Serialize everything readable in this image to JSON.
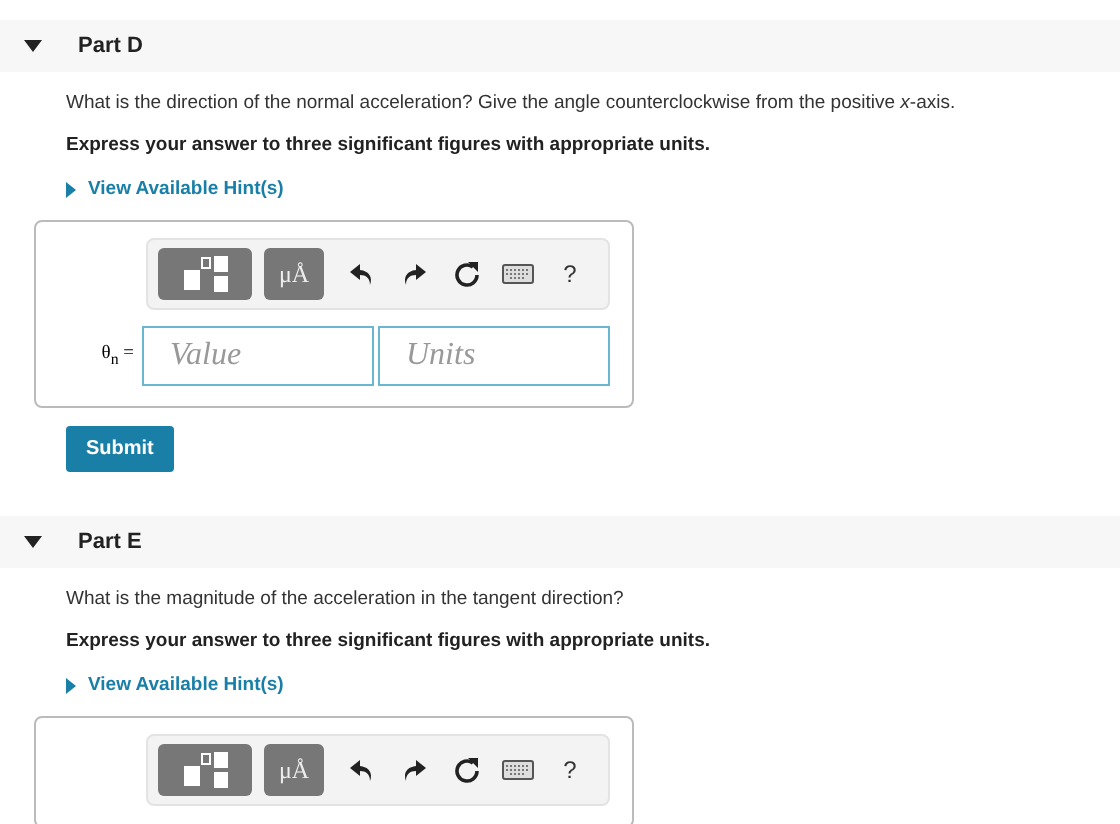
{
  "parts": [
    {
      "title": "Part D",
      "expanded": true,
      "question": "What is the direction of the normal acceleration? Give the angle counterclockwise from the positive *x*-axis.",
      "instruction": "Express your answer to three significant figures with appropriate units.",
      "hint_link": "View Available Hint(s)",
      "toolbar": {
        "units_button": "μÅ",
        "help": "?"
      },
      "answer": {
        "label": "θ$_{n}$ =",
        "value_placeholder": "Value",
        "units_placeholder": "Units"
      },
      "submit": "Submit"
    },
    {
      "title": "Part E",
      "expanded": true,
      "question": "What is the magnitude of the acceleration in the tangent direction?",
      "instruction": "Express your answer to three significant figures with appropriate units.",
      "hint_link": "View Available Hint(s)",
      "toolbar": {
        "units_button": "μÅ",
        "help": "?"
      }
    }
  ]
}
